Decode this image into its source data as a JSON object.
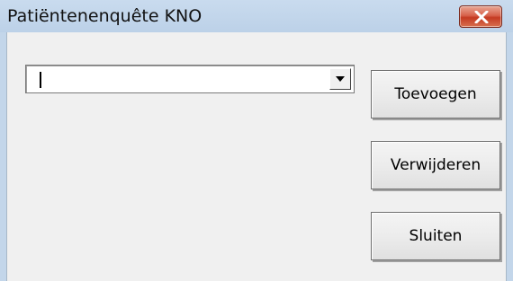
{
  "window": {
    "title": "Patiëntenenquête KNO"
  },
  "combobox": {
    "value": ""
  },
  "buttons": {
    "add_label": "Toevoegen",
    "remove_label": "Verwijderen",
    "close_label": "Sluiten"
  },
  "icons": {
    "close": "close-icon",
    "dropdown": "chevron-down-icon"
  },
  "colors": {
    "titlebar": "#bcd1e8",
    "close_button": "#c43a22",
    "client_background": "#f0f0f0"
  }
}
